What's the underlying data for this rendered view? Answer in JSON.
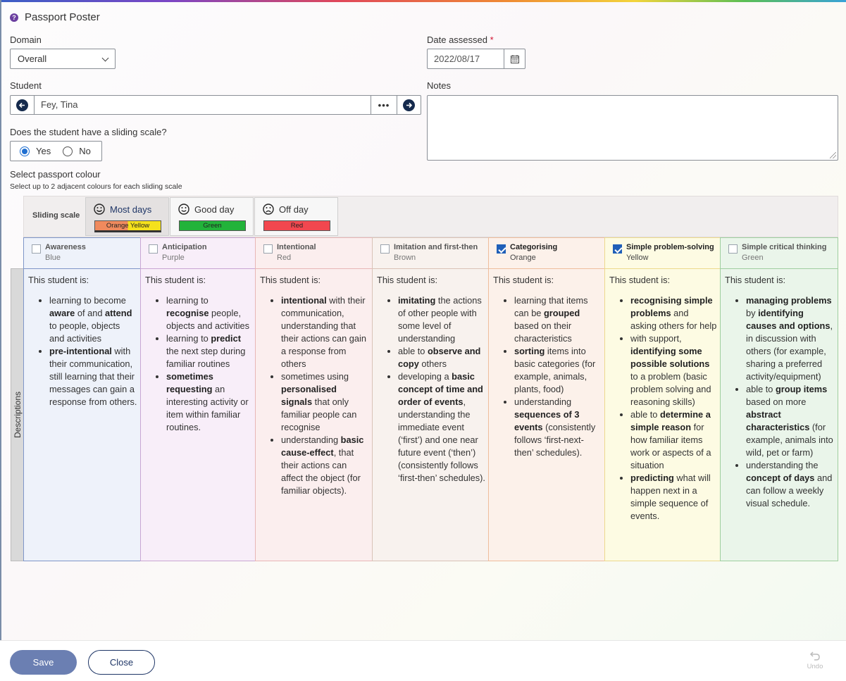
{
  "app": {
    "title": "Passport Poster",
    "help_glyph": "?"
  },
  "form": {
    "domain_label": "Domain",
    "domain_value": "Overall",
    "date_label": "Date assessed",
    "date_required": "*",
    "date_value": "2022/08/17",
    "student_label": "Student",
    "student_value": "Fey, Tina",
    "student_more": "•••",
    "notes_label": "Notes",
    "notes_value": "",
    "sliding_question": "Does the student have a sliding scale?",
    "sliding_options": [
      "Yes",
      "No"
    ],
    "sliding_selected": "Yes",
    "colour_label": "Select passport colour",
    "colour_hint": "Select up to 2 adjacent colours for each sliding scale"
  },
  "sliding_scale": {
    "label": "Sliding scale",
    "cards": [
      {
        "label": "Most days",
        "icon": "happy-face-icon",
        "chip": "Orange Yellow",
        "chip_colors": [
          "#f08a5d",
          "#f5e11c"
        ],
        "selected": true
      },
      {
        "label": "Good day",
        "icon": "smile-face-icon",
        "chip": "Green",
        "chip_colors": [
          "#22b33a",
          "#22b33a"
        ],
        "selected": false
      },
      {
        "label": "Off day",
        "icon": "sad-face-icon",
        "chip": "Red",
        "chip_colors": [
          "#f2474f",
          "#f2474f"
        ],
        "selected": false
      }
    ]
  },
  "descriptions_label": "Descriptions",
  "intro": "This student is:",
  "columns": [
    {
      "title": "Awareness",
      "colour": "Blue",
      "checked": false,
      "bg": "#eef2fa",
      "border": "#7f96c8"
    },
    {
      "title": "Anticipation",
      "colour": "Purple",
      "checked": false,
      "bg": "#f8eef9",
      "border": "#c9a6d3"
    },
    {
      "title": "Intentional",
      "colour": "Red",
      "checked": false,
      "bg": "#fbeeee",
      "border": "#e8b6b6"
    },
    {
      "title": "Imitation and first-then",
      "colour": "Brown",
      "checked": false,
      "bg": "#f8f2ee",
      "border": "#d9c2b6"
    },
    {
      "title": "Categorising",
      "colour": "Orange",
      "checked": true,
      "bg": "#fcf1ea",
      "border": "#eebd9c"
    },
    {
      "title": "Simple problem-solving",
      "colour": "Yellow",
      "checked": true,
      "bg": "#fdfbe3",
      "border": "#ecd98d"
    },
    {
      "title": "Simple critical thinking",
      "colour": "Green",
      "checked": false,
      "bg": "#eaf5ea",
      "border": "#9fce9f"
    }
  ],
  "footer": {
    "save": "Save",
    "close": "Close",
    "undo": "Undo"
  }
}
